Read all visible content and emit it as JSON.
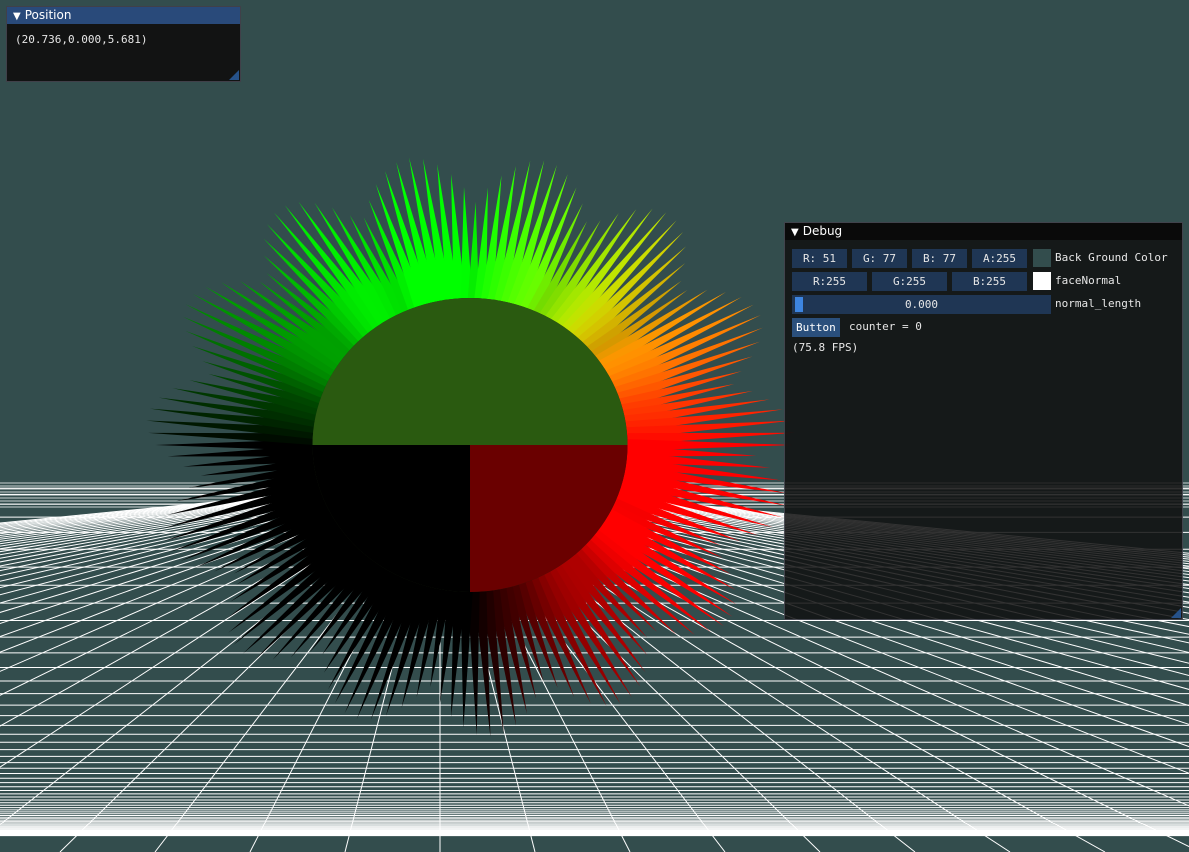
{
  "colors": {
    "background": "#334d4d",
    "grid_line": "#ffffff",
    "title_active": "#294a7a",
    "widget_bg": "#1f3654",
    "slider_grab": "#3d85e0",
    "button": "#2a4f7c"
  },
  "position_window": {
    "title": "Position",
    "text": "(20.736,0.000,5.681)"
  },
  "debug_window": {
    "title": "Debug",
    "background_color": {
      "r": "R: 51",
      "g": "G: 77",
      "b": "B: 77",
      "a": "A:255",
      "swatch": "#334d4d",
      "label": "Back Ground Color"
    },
    "face_normal": {
      "r": "R:255",
      "g": "G:255",
      "b": "B:255",
      "swatch": "#ffffff",
      "label": "faceNormal"
    },
    "normal_length": {
      "value_text": "0.000",
      "value": 0.0,
      "label": "normal_length"
    },
    "button_label": "Button",
    "counter_text": "counter = 0",
    "fps_text": "(75.8 FPS)"
  },
  "icons": {
    "collapse": "triangle-down-icon",
    "resize": "resize-grip-icon"
  }
}
